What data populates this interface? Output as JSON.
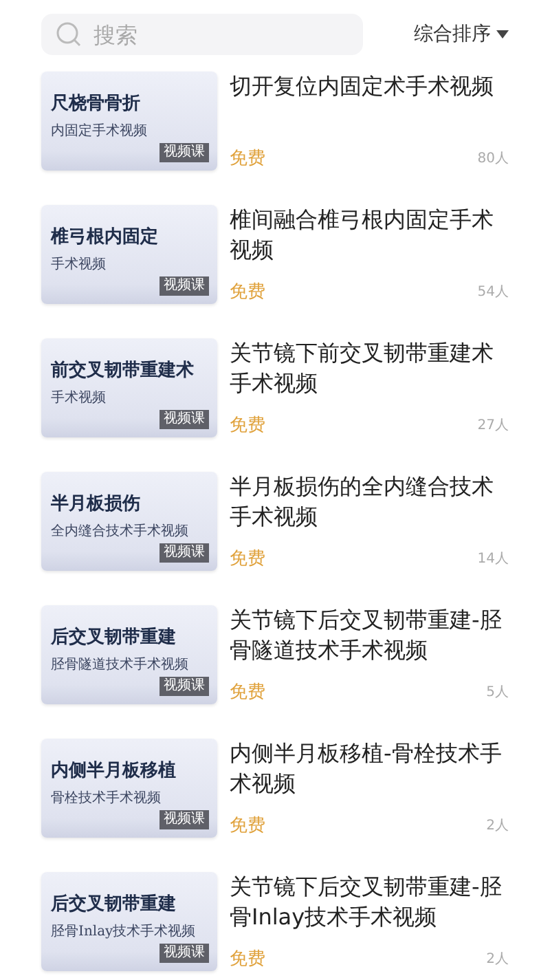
{
  "search": {
    "placeholder": "搜索"
  },
  "sort": {
    "label": "综合排序"
  },
  "courses": [
    {
      "thumb_title": "尺桡骨骨折",
      "thumb_subtitle": "内固定手术视频",
      "badge": "视频课",
      "title": "切开复位内固定术手术视频",
      "price": "免费",
      "count": "80人"
    },
    {
      "thumb_title": "椎弓根内固定",
      "thumb_subtitle": "手术视频",
      "badge": "视频课",
      "title": "椎间融合椎弓根内固定手术视频",
      "price": "免费",
      "count": "54人"
    },
    {
      "thumb_title": "前交叉韧带重建术",
      "thumb_subtitle": "手术视频",
      "badge": "视频课",
      "title": "关节镜下前交叉韧带重建术手术视频",
      "price": "免费",
      "count": "27人"
    },
    {
      "thumb_title": "半月板损伤",
      "thumb_subtitle": "全内缝合技术手术视频",
      "badge": "视频课",
      "title": "半月板损伤的全内缝合技术手术视频",
      "price": "免费",
      "count": "14人"
    },
    {
      "thumb_title": "后交叉韧带重建",
      "thumb_subtitle": "胫骨隧道技术手术视频",
      "badge": "视频课",
      "title": "关节镜下后交叉韧带重建-胫骨隧道技术手术视频",
      "price": "免费",
      "count": "5人"
    },
    {
      "thumb_title": "内侧半月板移植",
      "thumb_subtitle": "骨栓技术手术视频",
      "badge": "视频课",
      "title": "内侧半月板移植-骨栓技术手术视频",
      "price": "免费",
      "count": "2人"
    },
    {
      "thumb_title": "后交叉韧带重建",
      "thumb_subtitle": "胫骨Inlay技术手术视频",
      "badge": "视频课",
      "title": "关节镜下后交叉韧带重建-胫骨Inlay技术手术视频",
      "price": "免费",
      "count": "2人"
    }
  ]
}
